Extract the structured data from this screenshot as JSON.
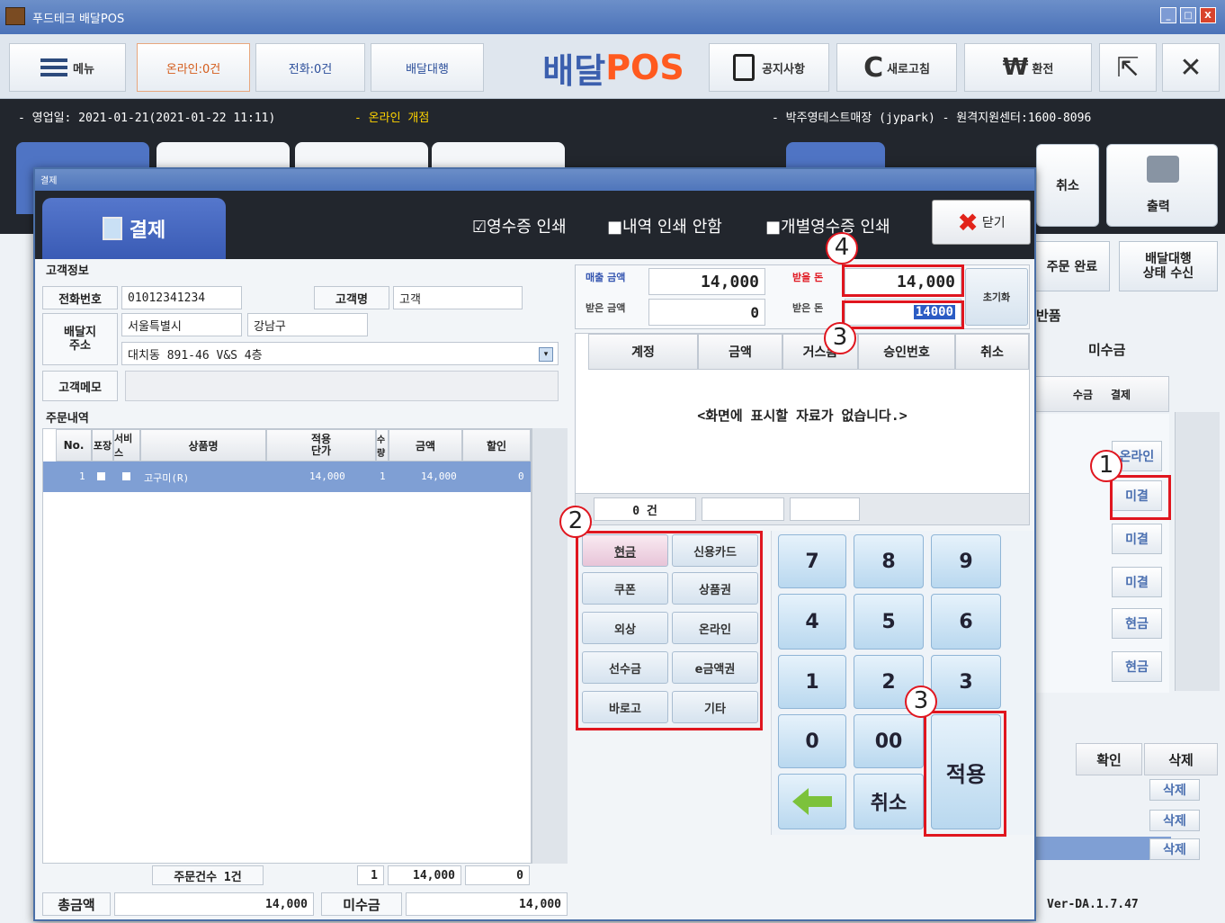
{
  "window": {
    "title": "푸드테크 배달POS",
    "min": "_",
    "max": "□",
    "close": "X"
  },
  "toolbar": {
    "menu": "메뉴",
    "online": "온라인:0건",
    "phone": "전화:0건",
    "delivery": "배달대행",
    "logo_a": "배달",
    "logo_b": "POS",
    "notice": "공지사항",
    "refresh": "새로고침",
    "exchange": "환전",
    "exit": "✕"
  },
  "infobar": {
    "left": "- 영업일: 2021-01-21(2021-01-22 11:11)",
    "open": "- 온라인 개점",
    "right": "- 박주영테스트매장 (jypark)  - 원격지원센터:1600-8096"
  },
  "bg": {
    "cancel": "취소",
    "print": "출력",
    "order_done": "주문 완료",
    "delivery_status": "배달대행\n상태 수신",
    "return": "반품",
    "unpaid_chk": "미수금",
    "col_status": "결제",
    "col_pay": "수금",
    "rows": [
      "온라인",
      "미결",
      "미결",
      "미결",
      "현금",
      "현금"
    ],
    "col_confirm": "확인",
    "col_delete": "삭제",
    "del": "삭제",
    "version": "Ver-DA.1.7.47"
  },
  "dialog": {
    "title": "결제",
    "tab": "결제",
    "opt_receipt": "☑영수증 인쇄",
    "opt_noprint": "■내역 인쇄 안함",
    "opt_each": "■개별영수증 인쇄",
    "close": "닫기"
  },
  "customer": {
    "section": "고객정보",
    "phone_label": "전화번호",
    "phone": "01012341234",
    "name_label": "고객명",
    "name": "고객",
    "addr_label": "배달지\n주소",
    "city": "서울특별시",
    "district": "강남구",
    "addr": "대치동 891-46 V&S 4층",
    "memo_label": "고객메모",
    "memo": ""
  },
  "order": {
    "section": "주문내역",
    "headers": [
      "No.",
      "포장",
      "서비스",
      "상품명",
      "적용\n단가",
      "수량",
      "금액",
      "할인"
    ],
    "rows": [
      {
        "no": "1",
        "name": "고구미(R)",
        "price": "14,000",
        "qty": "1",
        "amount": "14,000",
        "disc": "0"
      }
    ],
    "footer_label": "주문건수 1건",
    "footer_qty": "1",
    "footer_amount": "14,000",
    "footer_disc": "0"
  },
  "totals": {
    "total_label": "총금액",
    "total": "14,000",
    "unpaid_label": "미수금",
    "unpaid": "14,000"
  },
  "payment": {
    "sales_label": "매출 금액",
    "sales": "14,000",
    "received_label": "받은 금액",
    "received": "0",
    "receive_label": "받을 돈",
    "receive": "14,000",
    "got_label": "받은 돈",
    "got": "14000",
    "reset": "초기화",
    "cols": [
      "계정",
      "금액",
      "거스름",
      "승인번호",
      "취소"
    ],
    "empty": "<화면에 표시할 자료가 없습니다.>",
    "count": "0 건"
  },
  "methods": [
    "현금",
    "신용카드",
    "쿠폰",
    "상품권",
    "외상",
    "온라인",
    "선수금",
    "e금액권",
    "바로고",
    "기타"
  ],
  "keypad": {
    "keys": [
      "7",
      "8",
      "9",
      "4",
      "5",
      "6",
      "1",
      "2",
      "3",
      "0",
      "00"
    ],
    "cancel": "취소",
    "apply": "적용"
  },
  "markers": {
    "m1": "1",
    "m2": "2",
    "m3a": "3",
    "m3b": "3",
    "m4": "4"
  }
}
